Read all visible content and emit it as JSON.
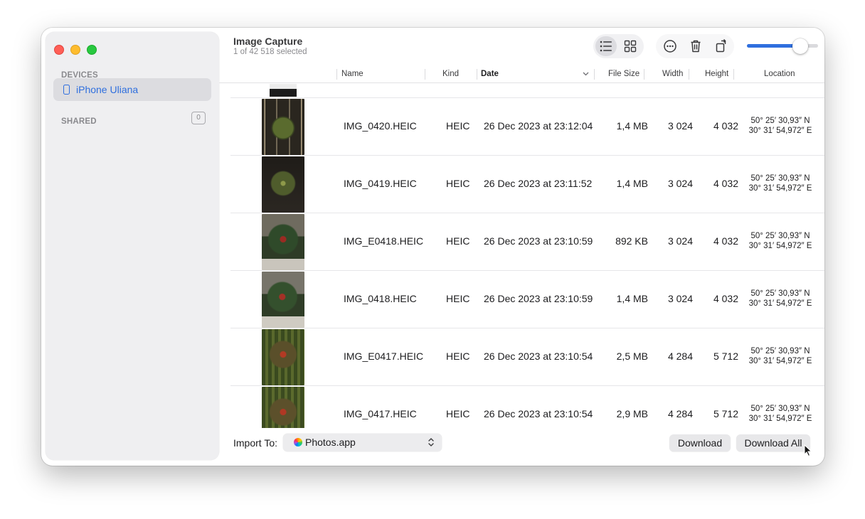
{
  "window": {
    "title": "Image Capture",
    "subtitle": "1 of 42 518 selected"
  },
  "sidebar": {
    "devices_heading": "DEVICES",
    "device": {
      "label": "iPhone Uliana",
      "icon": "iphone-icon"
    },
    "shared_heading": "SHARED",
    "shared_count": "0"
  },
  "toolbar": {
    "view_list_icon": "list-view-icon",
    "view_grid_icon": "grid-view-icon",
    "more_icon": "ellipsis-circle-icon",
    "delete_icon": "trash-icon",
    "rotate_icon": "rotate-icon",
    "thumbnail_size_fraction": 0.75,
    "accent_color": "#2f6fde"
  },
  "table": {
    "columns": {
      "name": "Name",
      "kind": "Kind",
      "date": "Date",
      "size": "File Size",
      "width": "Width",
      "height": "Height",
      "location": "Location"
    },
    "rows": [
      {
        "name": "IMG_0420.HEIC",
        "kind": "HEIC",
        "date": "26 Dec 2023 at 23:12:04",
        "size": "1,4 MB",
        "width": "3 024",
        "height": "4 032",
        "lat": "50° 25′ 30,93″ N",
        "lon": "30° 31′ 54,972″ E"
      },
      {
        "name": "IMG_0419.HEIC",
        "kind": "HEIC",
        "date": "26 Dec 2023 at 23:11:52",
        "size": "1,4 MB",
        "width": "3 024",
        "height": "4 032",
        "lat": "50° 25′ 30,93″ N",
        "lon": "30° 31′ 54,972″ E"
      },
      {
        "name": "IMG_E0418.HEIC",
        "kind": "HEIC",
        "date": "26 Dec 2023 at 23:10:59",
        "size": "892 KB",
        "width": "3 024",
        "height": "4 032",
        "lat": "50° 25′ 30,93″ N",
        "lon": "30° 31′ 54,972″ E"
      },
      {
        "name": "IMG_0418.HEIC",
        "kind": "HEIC",
        "date": "26 Dec 2023 at 23:10:59",
        "size": "1,4 MB",
        "width": "3 024",
        "height": "4 032",
        "lat": "50° 25′ 30,93″ N",
        "lon": "30° 31′ 54,972″ E"
      },
      {
        "name": "IMG_E0417.HEIC",
        "kind": "HEIC",
        "date": "26 Dec 2023 at 23:10:54",
        "size": "2,5 MB",
        "width": "4 284",
        "height": "5 712",
        "lat": "50° 25′ 30,93″ N",
        "lon": "30° 31′ 54,972″ E"
      },
      {
        "name": "IMG_0417.HEIC",
        "kind": "HEIC",
        "date": "26 Dec 2023 at 23:10:54",
        "size": "2,9 MB",
        "width": "4 284",
        "height": "5 712",
        "lat": "50° 25′ 30,93″ N",
        "lon": "30° 31′ 54,972″ E"
      }
    ]
  },
  "footer": {
    "import_label": "Import To:",
    "import_value": "Photos.app",
    "download_label": "Download",
    "download_all_label": "Download All"
  }
}
